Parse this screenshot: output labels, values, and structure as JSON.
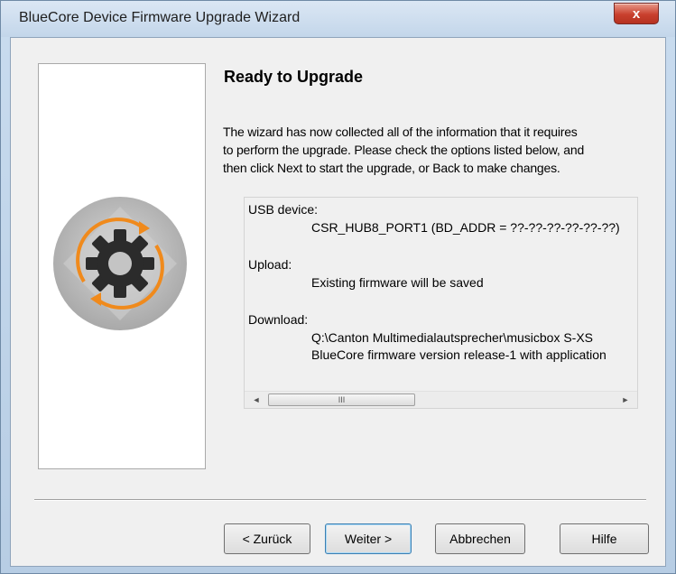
{
  "window": {
    "title": "BlueCore Device Firmware Upgrade Wizard",
    "close_label": "x"
  },
  "logo": {
    "icon": "gear-with-circular-arrows-icon"
  },
  "page": {
    "heading": "Ready to Upgrade",
    "intro_lines": [
      "The wizard has now collected all of the information that it requires",
      "to perform the upgrade. Please check the options listed below, and",
      "then click Next to start the upgrade, or Back to make changes."
    ]
  },
  "summary": {
    "usb_label": "USB device:",
    "usb_value": "CSR_HUB8_PORT1 (BD_ADDR = ??-??-??-??-??-??)",
    "upload_label": "Upload:",
    "upload_value": "Existing firmware will be saved",
    "download_label": "Download:",
    "download_path": "Q:\\Canton Multimedialautsprecher\\musicbox S-XS",
    "download_version": "BlueCore firmware version release-1 with application",
    "scroll_left": "◄",
    "scroll_right": "►",
    "scroll_grip": "III"
  },
  "buttons": {
    "back": "< Zurück",
    "next": "Weiter >",
    "cancel": "Abbrechen",
    "help": "Hilfe"
  },
  "colors": {
    "accent_orange": "#f08a1c",
    "gear": "#2b2b2b",
    "disc": "#bdbdbd"
  }
}
